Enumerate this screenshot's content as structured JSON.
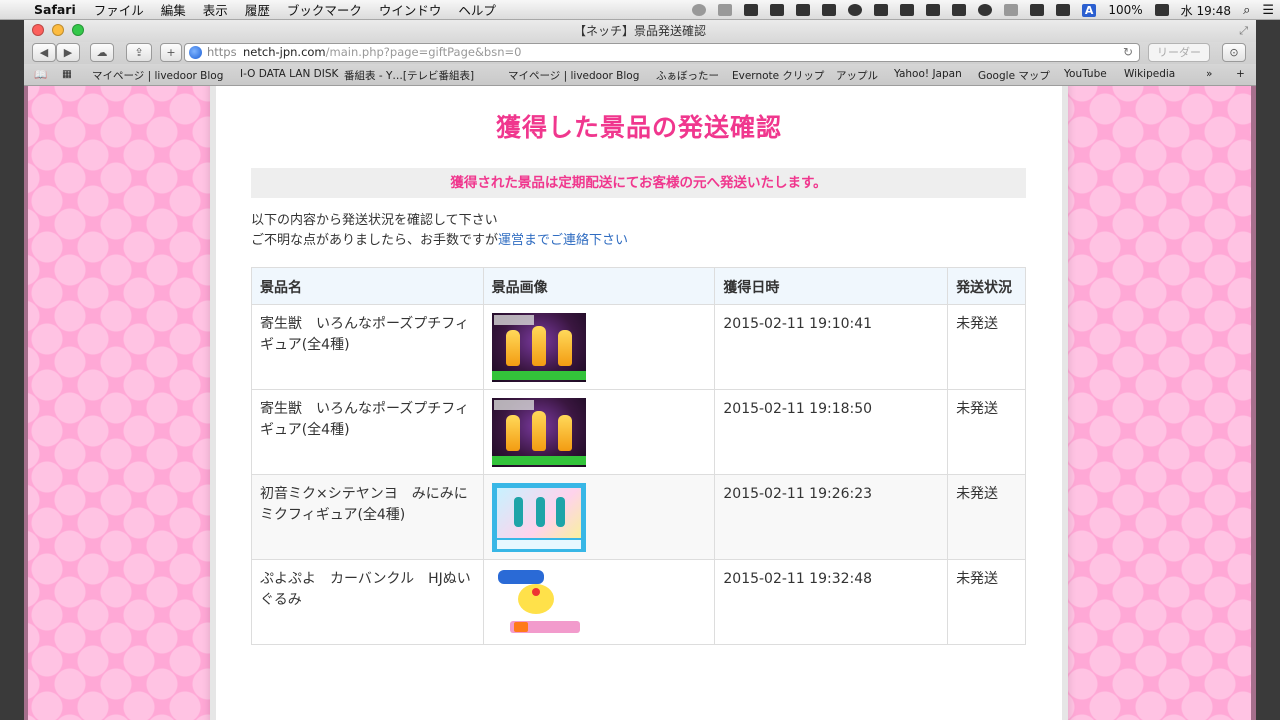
{
  "menubar": {
    "app_name": "Safari",
    "menus": [
      "ファイル",
      "編集",
      "表示",
      "履歴",
      "ブックマーク",
      "ウインドウ",
      "ヘルプ"
    ],
    "battery": "100%",
    "clock": "水 19:48",
    "ime_label": "A"
  },
  "window": {
    "title": "【ネッチ】景品発送確認",
    "url_scheme": "https",
    "url_host": "netch-jpn.com",
    "url_path": "/main.php?page=giftPage&bsn=0",
    "reader_label": "リーダー"
  },
  "bookmarks": [
    "マイページ | livedoor Blog",
    "I-O DATA LAN DISK",
    "番組表 - Y…[テレビ番組表]",
    "マイページ | livedoor Blog",
    "ふぁぼったー",
    "Evernote クリップ",
    "アップル",
    "Yahoo! Japan",
    "Google マップ",
    "YouTube",
    "Wikipedia"
  ],
  "page": {
    "title": "獲得した景品の発送確認",
    "notice": "獲得された景品は定期配送にてお客様の元へ発送いたします。",
    "instruction_line1": "以下の内容から発送状況を確認して下さい",
    "instruction_line2_prefix": "ご不明な点がありましたら、お手数ですが",
    "contact_link": "運営までご連絡下さい"
  },
  "table": {
    "headers": [
      "景品名",
      "景品画像",
      "獲得日時",
      "発送状況"
    ],
    "rows": [
      {
        "name": "寄生獣　いろんなポーズプチフィギュア(全4種)",
        "image": "parasyte-figure-thumbnail",
        "date": "2015-02-11 19:10:41",
        "status": "未発送"
      },
      {
        "name": "寄生獣　いろんなポーズプチフィギュア(全4種)",
        "image": "parasyte-figure-thumbnail",
        "date": "2015-02-11 19:18:50",
        "status": "未発送"
      },
      {
        "name": "初音ミク×シテヤンヨ　みにみにミクフィギュア(全4種)",
        "image": "miku-figure-thumbnail",
        "date": "2015-02-11 19:26:23",
        "status": "未発送"
      },
      {
        "name": "ぷよぷよ　カーバンクル　HJぬいぐるみ",
        "image": "puyo-plush-thumbnail",
        "date": "2015-02-11 19:32:48",
        "status": "未発送"
      }
    ]
  },
  "colors": {
    "accent_pink": "#f0378e",
    "link_blue": "#2f6cc1",
    "background_pink": "#ffa8d6"
  }
}
